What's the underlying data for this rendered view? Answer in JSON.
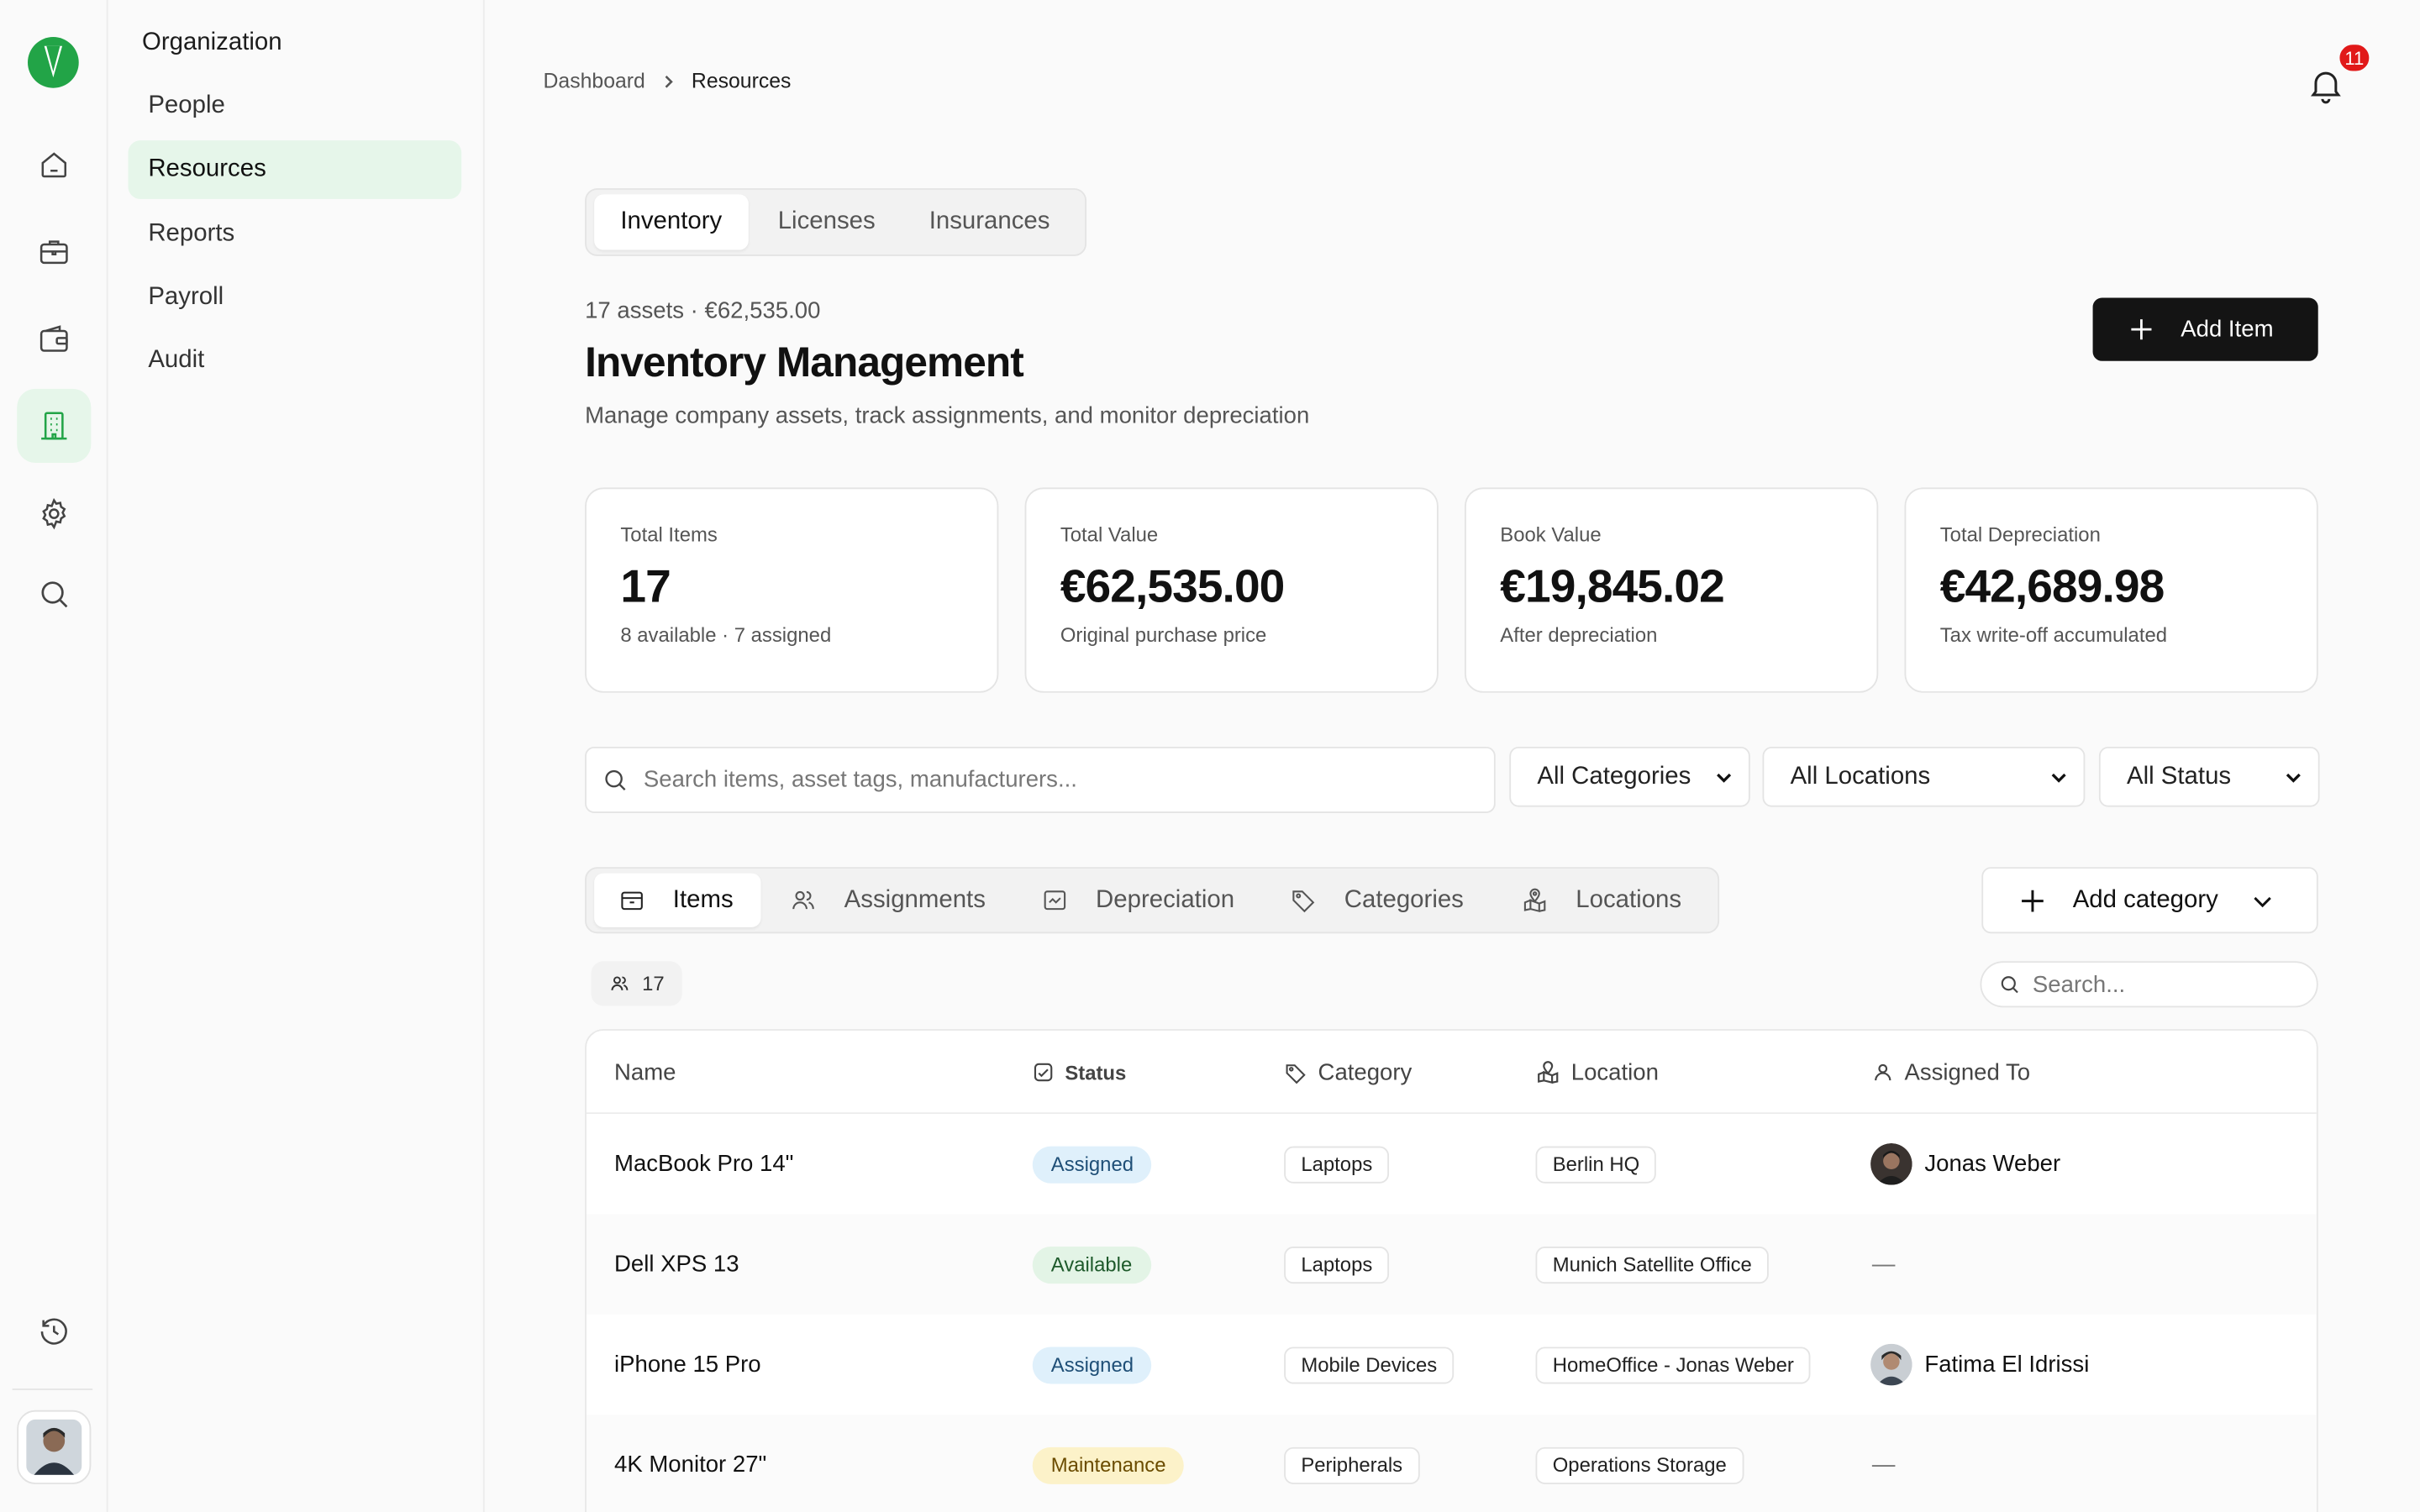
{
  "app": {
    "colors": {
      "brand": "#22a447",
      "accent_bg": "#e6f6ea",
      "badge": "#e11919",
      "primary_button": "#141414"
    }
  },
  "rail": {
    "icons": [
      "home-icon",
      "briefcase-icon",
      "wallet-icon",
      "building-icon",
      "gear-icon",
      "search-icon",
      "clock-history-icon"
    ]
  },
  "sidebar": {
    "heading": "Organization",
    "items": [
      {
        "label": "People"
      },
      {
        "label": "Resources",
        "active": true
      },
      {
        "label": "Reports"
      },
      {
        "label": "Payroll"
      },
      {
        "label": "Audit"
      }
    ]
  },
  "breadcrumb": {
    "parent": "Dashboard",
    "current": "Resources"
  },
  "notifications": {
    "count": "11"
  },
  "top_tabs": [
    {
      "label": "Inventory",
      "active": true
    },
    {
      "label": "Licenses"
    },
    {
      "label": "Insurances"
    }
  ],
  "header": {
    "subline": "17 assets · €62,535.00",
    "title": "Inventory Management",
    "description": "Manage company assets, track assignments, and monitor depreciation",
    "add_button": "Add Item"
  },
  "stats": [
    {
      "label": "Total Items",
      "value": "17",
      "sub": "8 available · 7 assigned"
    },
    {
      "label": "Total Value",
      "value": "€62,535.00",
      "sub": "Original purchase price"
    },
    {
      "label": "Book Value",
      "value": "€19,845.02",
      "sub": "After depreciation"
    },
    {
      "label": "Total Depreciation",
      "value": "€42,689.98",
      "sub": "Tax write-off accumulated"
    }
  ],
  "filters": {
    "search_placeholder": "Search items, asset tags, manufacturers...",
    "category": "All Categories",
    "location": "All Locations",
    "status": "All Status"
  },
  "sub_tabs": [
    {
      "label": "Items",
      "icon": "box-icon",
      "active": true
    },
    {
      "label": "Assignments",
      "icon": "users-icon"
    },
    {
      "label": "Depreciation",
      "icon": "chart-icon"
    },
    {
      "label": "Categories",
      "icon": "tag-icon"
    },
    {
      "label": "Locations",
      "icon": "map-icon"
    }
  ],
  "add_category": "Add category",
  "table": {
    "count": "17",
    "search_placeholder": "Search...",
    "columns": {
      "name": "Name",
      "status": "Status",
      "category": "Category",
      "location": "Location",
      "assigned": "Assigned To"
    },
    "rows": [
      {
        "name": "MacBook Pro 14\"",
        "status": "Assigned",
        "status_type": "assigned",
        "category": "Laptops",
        "location": "Berlin HQ",
        "assigned": "Jonas Weber"
      },
      {
        "name": "Dell XPS 13",
        "status": "Available",
        "status_type": "available",
        "category": "Laptops",
        "location": "Munich Satellite Office",
        "assigned": "—"
      },
      {
        "name": "iPhone 15 Pro",
        "status": "Assigned",
        "status_type": "assigned",
        "category": "Mobile Devices",
        "location": "HomeOffice - Jonas Weber",
        "assigned": "Fatima El Idrissi"
      },
      {
        "name": "4K Monitor 27\"",
        "status": "Maintenance",
        "status_type": "maintenance",
        "category": "Peripherals",
        "location": "Operations Storage",
        "assigned": "—"
      }
    ]
  }
}
